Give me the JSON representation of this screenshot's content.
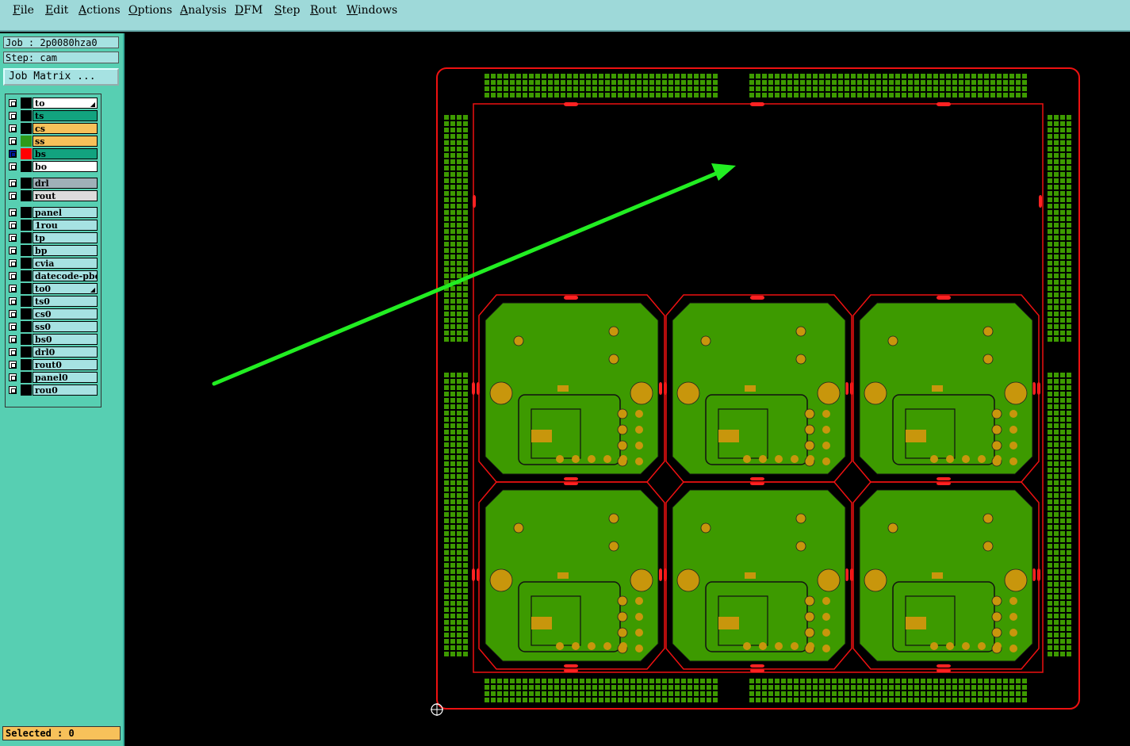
{
  "menu": [
    "File",
    "Edit",
    "Actions",
    "Options",
    "Analysis",
    "DFM",
    "Step",
    "Rout",
    "Windows"
  ],
  "job": "Job : 2p0080hza0",
  "step": "Step: cam",
  "job_matrix_label": "Job Matrix ...",
  "selected": "Selected : 0",
  "layers": [
    {
      "name": "to",
      "bg": "#ffffff",
      "swatch": "#000000",
      "marker": true
    },
    {
      "name": "ts",
      "bg": "#12a37f",
      "swatch": "#000000"
    },
    {
      "name": "cs",
      "bg": "#f7c15a",
      "swatch": "#000000"
    },
    {
      "name": "ss",
      "bg": "#f7c15a",
      "swatch": "#2e9a1a"
    },
    {
      "name": "bs",
      "bg": "#12a37f",
      "swatch": "#ff0000",
      "active": true
    },
    {
      "name": "bo",
      "bg": "#ffffff",
      "swatch": "#000000"
    },
    {
      "name": "drl",
      "bg": "#9fb0b8",
      "swatch": "#000000",
      "gap": true
    },
    {
      "name": "rout",
      "bg": "#dcdcdc",
      "swatch": "#000000"
    },
    {
      "name": "panel",
      "bg": "#a6e2e2",
      "swatch": "#000000",
      "gap": true
    },
    {
      "name": "1rou",
      "bg": "#a6e2e2",
      "swatch": "#000000"
    },
    {
      "name": "tp",
      "bg": "#a6e2e2",
      "swatch": "#000000"
    },
    {
      "name": "bp",
      "bg": "#a6e2e2",
      "swatch": "#000000"
    },
    {
      "name": "cvia",
      "bg": "#a6e2e2",
      "swatch": "#000000"
    },
    {
      "name": "datecode-pbe",
      "bg": "#a6e2e2",
      "swatch": "#000000"
    },
    {
      "name": "to0",
      "bg": "#a6e2e2",
      "swatch": "#000000",
      "marker": true
    },
    {
      "name": "ts0",
      "bg": "#a6e2e2",
      "swatch": "#000000"
    },
    {
      "name": "cs0",
      "bg": "#a6e2e2",
      "swatch": "#000000"
    },
    {
      "name": "ss0",
      "bg": "#a6e2e2",
      "swatch": "#000000"
    },
    {
      "name": "bs0",
      "bg": "#a6e2e2",
      "swatch": "#000000"
    },
    {
      "name": "drl0",
      "bg": "#a6e2e2",
      "swatch": "#000000"
    },
    {
      "name": "rout0",
      "bg": "#a6e2e2",
      "swatch": "#000000"
    },
    {
      "name": "panel0",
      "bg": "#a6e2e2",
      "swatch": "#000000"
    },
    {
      "name": "rou0",
      "bg": "#a6e2e2",
      "swatch": "#000000"
    }
  ],
  "colors": {
    "board": "#3d9a00",
    "pad": "#c8960c",
    "outline": "#e11",
    "dots": "#3d9a00",
    "arrow": "#22ee22"
  }
}
